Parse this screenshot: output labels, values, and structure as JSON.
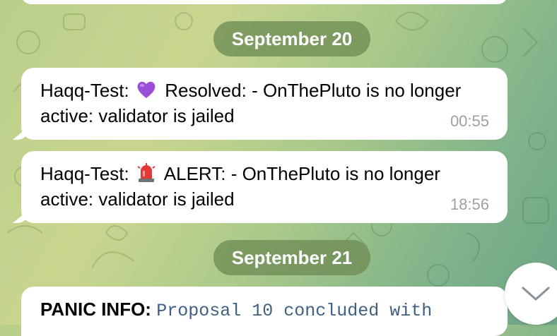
{
  "date_separators": [
    "September 20",
    "September 21"
  ],
  "messages": [
    {
      "sender": "Haqq-Test:",
      "emoji": "purple-heart-icon",
      "status": "Resolved:",
      "text": "- OnThePluto is no longer active: validator is jailed",
      "time": "00:55"
    },
    {
      "sender": "Haqq-Test:",
      "emoji": "police-light-icon",
      "status": "ALERT:",
      "text": "- OnThePluto is no longer active: validator is jailed",
      "time": "18:56"
    },
    {
      "label": "PANIC INFO:",
      "text": "Proposal 10 concluded with"
    }
  ],
  "scroll_button": {
    "icon": "chevron-down-icon"
  },
  "colors": {
    "date_pill": "#6e8c55",
    "bubble": "#ffffff",
    "timestamp": "#9aa2a7",
    "code_text": "#3f5f84"
  }
}
